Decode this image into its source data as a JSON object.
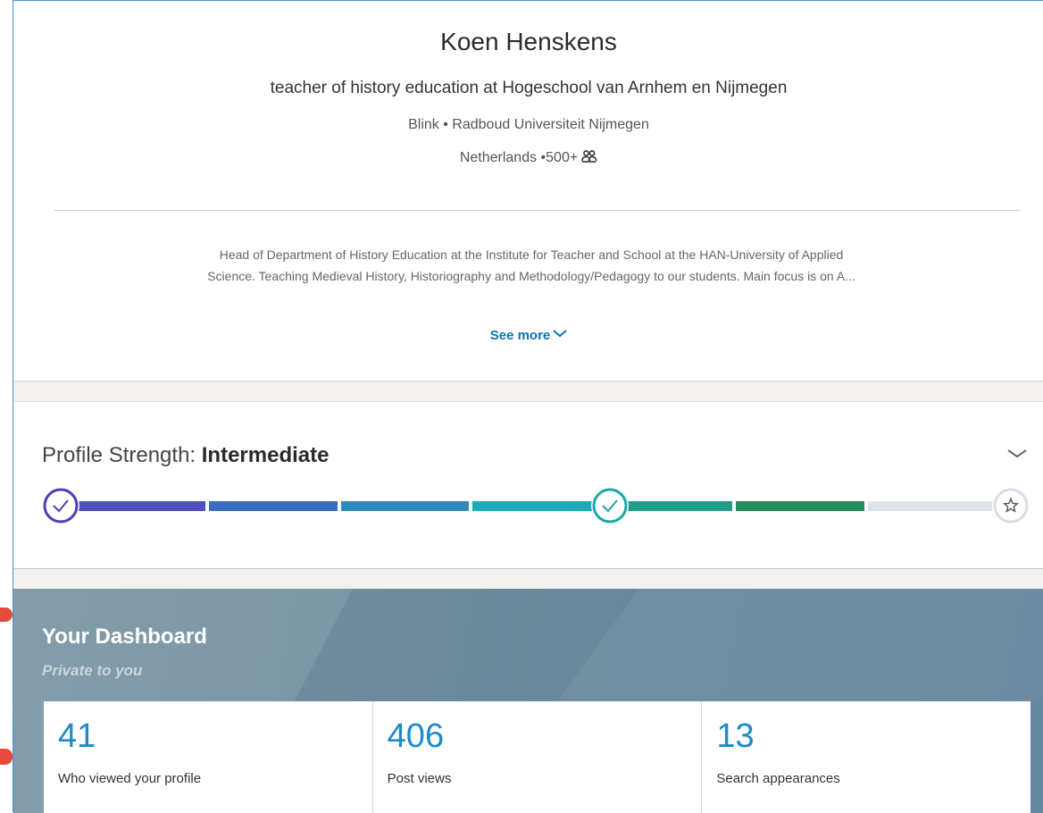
{
  "profile": {
    "name": "Koen Henskens",
    "headline": "teacher of history education at Hogeschool van Arnhem en Nijmegen",
    "companies": "Blink • Radboud Universiteit Nijmegen",
    "location": "Netherlands",
    "connections": "•500+",
    "connections_icon": "people-icon",
    "summary_line1": "Head of Department of History Education at the Institute for Teacher and School at the HAN-University of Applied",
    "summary_line2": "Science. Teaching Medieval History, Historiography and Methodology/Pedagogy to our students. Main focus is on A...",
    "see_more_label": "See more",
    "see_more_icon": "chevron-down-icon"
  },
  "profile_strength": {
    "label": "Profile Strength: ",
    "level": "Intermediate",
    "completed_fraction": 0.86,
    "collapse_icon": "chevron-down-icon",
    "start_icon": "check-icon",
    "mid_icon": "check-icon",
    "end_icon": "star-icon"
  },
  "dashboard": {
    "title": "Your Dashboard",
    "subtitle": "Private to you",
    "stats": [
      {
        "value": "41",
        "label": "Who viewed your profile"
      },
      {
        "value": "406",
        "label": "Post views"
      },
      {
        "value": "13",
        "label": "Search appearances"
      }
    ]
  },
  "colors": {
    "link": "#0a74b8",
    "stat_number": "#1e8ac9",
    "meter_segments": [
      "#4f4fbf",
      "#3a6cbf",
      "#2e8aba",
      "#20aab8",
      "#1e9e8a",
      "#22905e",
      "#dde3e8"
    ],
    "dashboard_bg": "#718e9f"
  }
}
